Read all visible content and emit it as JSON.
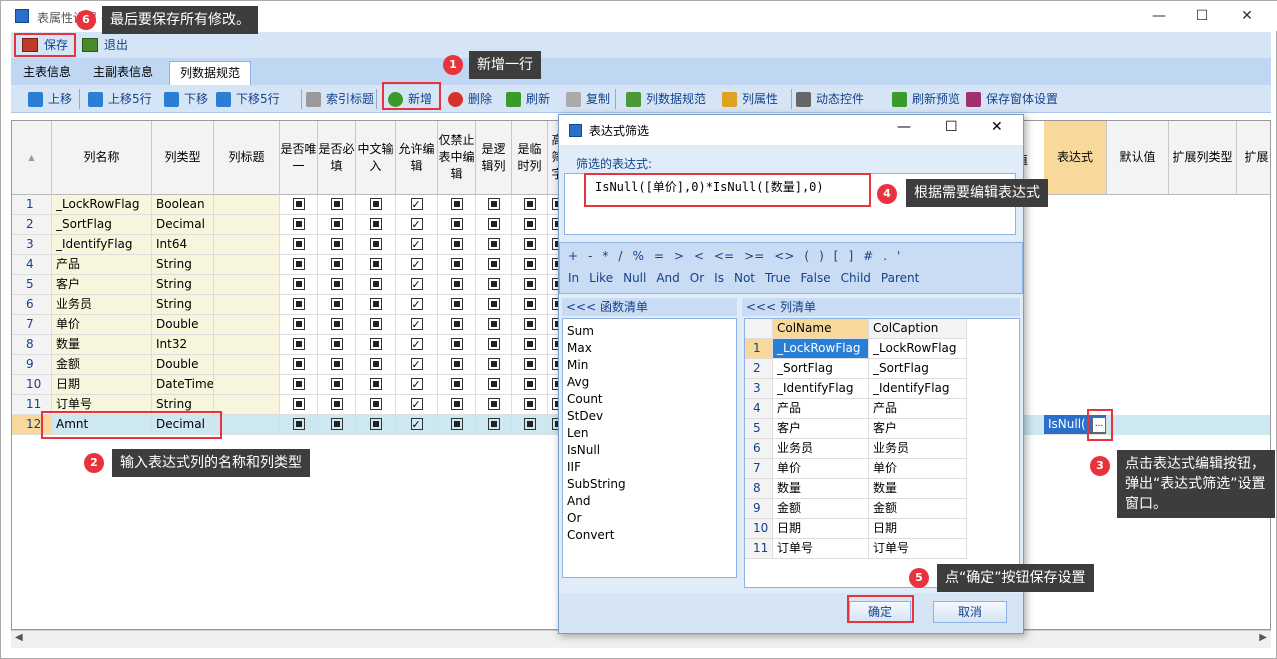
{
  "window": {
    "title": "表属性设置 - 模块"
  },
  "menubar": {
    "save": "保存",
    "exit": "退出"
  },
  "tabs": [
    "主表信息",
    "主副表信息",
    "列数据规范"
  ],
  "toolbar": [
    {
      "label": "上移",
      "icon": "arrow-up-icon"
    },
    {
      "label": "上移5行",
      "icon": "arrow-up-icon"
    },
    {
      "label": "下移",
      "icon": "arrow-down-icon"
    },
    {
      "label": "下移5行",
      "icon": "arrow-down-icon"
    },
    {
      "label": "索引标题",
      "icon": "document-icon"
    },
    {
      "label": "新增",
      "icon": "add-icon"
    },
    {
      "label": "删除",
      "icon": "delete-icon"
    },
    {
      "label": "刷新",
      "icon": "refresh-icon"
    },
    {
      "label": "复制",
      "icon": "copy-icon"
    },
    {
      "label": "列数据规范",
      "icon": "columns-icon"
    },
    {
      "label": "列属性",
      "icon": "pencil-icon"
    },
    {
      "label": "动态控件",
      "icon": "control-icon"
    },
    {
      "label": "刷新预览",
      "icon": "refresh-icon"
    },
    {
      "label": "保存窗体设置",
      "icon": "save-icon"
    }
  ],
  "grid": {
    "headers": [
      "列名称",
      "列类型",
      "列标题",
      "是否唯一",
      "是否必填",
      "中文输入",
      "允许编辑",
      "仅禁止表中编辑",
      "是逻辑列",
      "是临时列",
      "高筛字"
    ],
    "right_headers": [
      "表达式",
      "默认值",
      "扩展列类型",
      "扩展"
    ],
    "hidden_header_tail": "值",
    "rows": [
      {
        "n": "1",
        "name": "_LockRowFlag",
        "type": "Boolean"
      },
      {
        "n": "2",
        "name": "_SortFlag",
        "type": "Decimal"
      },
      {
        "n": "3",
        "name": "_IdentifyFlag",
        "type": "Int64"
      },
      {
        "n": "4",
        "name": "产品",
        "type": "String"
      },
      {
        "n": "5",
        "name": "客户",
        "type": "String"
      },
      {
        "n": "6",
        "name": "业务员",
        "type": "String"
      },
      {
        "n": "7",
        "name": "单价",
        "type": "Double"
      },
      {
        "n": "8",
        "name": "数量",
        "type": "Int32"
      },
      {
        "n": "9",
        "name": "金额",
        "type": "Double"
      },
      {
        "n": "10",
        "name": "日期",
        "type": "DateTime"
      },
      {
        "n": "11",
        "name": "订单号",
        "type": "String"
      },
      {
        "n": "12",
        "name": "Amnt",
        "type": "Decimal"
      }
    ],
    "expr_value": "IsNull(",
    "expr_button": "..."
  },
  "dialog": {
    "title": "表达式筛选",
    "expr_label": "筛选的表达式:",
    "expression": "IsNull([单价],0)*IsNull([数量],0)",
    "ops1": [
      "+",
      "-",
      "*",
      "/",
      "%",
      "=",
      ">",
      "<",
      "<=",
      ">=",
      "<>",
      "(",
      ")",
      "[",
      "]",
      "#",
      ".",
      "'"
    ],
    "ops2": [
      "In",
      "Like",
      "Null",
      "And",
      "Or",
      "Is",
      "Not",
      "True",
      "False",
      "Child",
      "Parent"
    ],
    "func_header": "<<< 函数清单",
    "col_header": "<<< 列清单",
    "functions": [
      "Sum",
      "Max",
      "Min",
      "Avg",
      "Count",
      "StDev",
      "Len",
      "IsNull",
      "IIF",
      "SubString",
      "And",
      "Or",
      "Convert"
    ],
    "col_headers": [
      "ColName",
      "ColCaption"
    ],
    "columns": [
      [
        "1",
        "_LockRowFlag",
        "_LockRowFlag"
      ],
      [
        "2",
        "_SortFlag",
        "_SortFlag"
      ],
      [
        "3",
        "_IdentifyFlag",
        "_IdentifyFlag"
      ],
      [
        "4",
        "产品",
        "产品"
      ],
      [
        "5",
        "客户",
        "客户"
      ],
      [
        "6",
        "业务员",
        "业务员"
      ],
      [
        "7",
        "单价",
        "单价"
      ],
      [
        "8",
        "数量",
        "数量"
      ],
      [
        "9",
        "金额",
        "金额"
      ],
      [
        "10",
        "日期",
        "日期"
      ],
      [
        "11",
        "订单号",
        "订单号"
      ]
    ],
    "ok": "确定",
    "cancel": "取消"
  },
  "callouts": [
    {
      "n": "1",
      "text": "新增一行"
    },
    {
      "n": "2",
      "text": "输入表达式列的名称和列类型"
    },
    {
      "n": "3",
      "text": "点击表达式编辑按钮，弹出“表达式筛选”设置窗口。"
    },
    {
      "n": "4",
      "text": "根据需要编辑表达式"
    },
    {
      "n": "5",
      "text": "点“确定”按钮保存设置"
    },
    {
      "n": "6",
      "text": "最后要保存所有修改。"
    }
  ],
  "colors": {
    "accent": "#e8323c",
    "callout_bg": "#3d3d3d",
    "ribbon": "#d6e5f5",
    "selected_row": "#cde8f0"
  }
}
